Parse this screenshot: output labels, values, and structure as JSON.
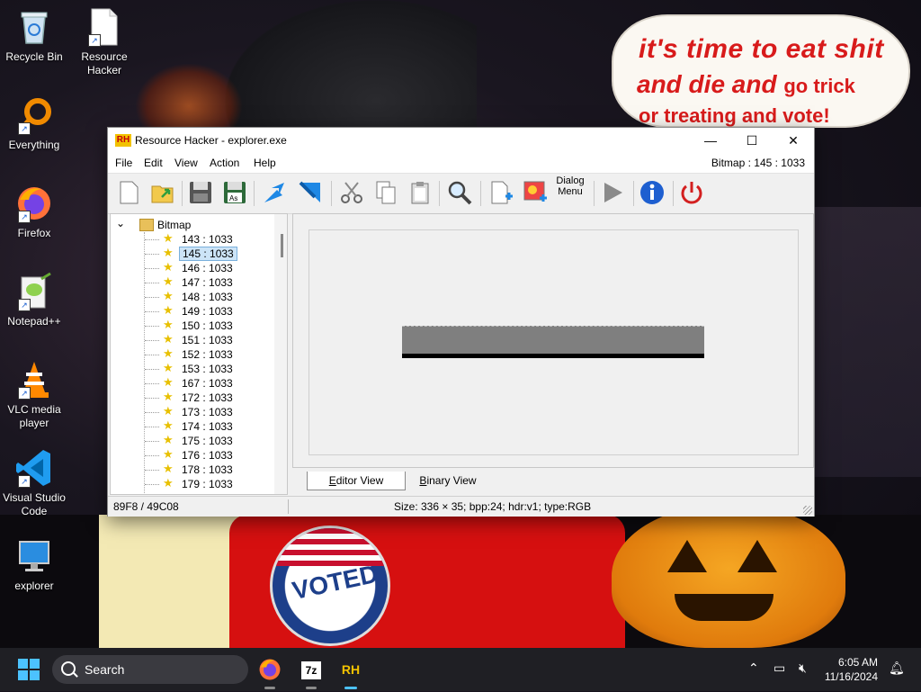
{
  "wallpaper": {
    "speech_line1": "it's time to eat shit",
    "speech_line2a": "and die and",
    "speech_line2b": "go trick",
    "speech_line3": "or treating and vote!",
    "button_text": "I VOTED"
  },
  "desktop_icons": [
    {
      "label": "Recycle Bin"
    },
    {
      "label": "Resource Hacker"
    },
    {
      "label": "Everything"
    },
    {
      "label": "Firefox"
    },
    {
      "label": "Notepad++"
    },
    {
      "label": "VLC media player"
    },
    {
      "label": "Visual Studio Code"
    },
    {
      "label": "explorer"
    }
  ],
  "window": {
    "app_icon_text": "RH",
    "title": "Resource Hacker - explorer.exe",
    "minimize": "—",
    "maximize": "☐",
    "close": "✕",
    "menu": [
      "File",
      "Edit",
      "View",
      "Action",
      "Help"
    ],
    "resource_info": "Bitmap : 145 : 1033",
    "toolbar": {
      "dialog_menu_label1": "Dialog",
      "dialog_menu_label2": "Menu"
    },
    "tree": {
      "root": "Bitmap",
      "items": [
        "143 : 1033",
        "145 : 1033",
        "146 : 1033",
        "147 : 1033",
        "148 : 1033",
        "149 : 1033",
        "150 : 1033",
        "151 : 1033",
        "152 : 1033",
        "153 : 1033",
        "167 : 1033",
        "172 : 1033",
        "173 : 1033",
        "174 : 1033",
        "175 : 1033",
        "176 : 1033",
        "178 : 1033",
        "179 : 1033"
      ],
      "selected_index": 1
    },
    "tabs": {
      "editor_prefix": "E",
      "editor_rest": "ditor View",
      "binary_prefix": "B",
      "binary_rest": "inary View"
    },
    "status_left": "89F8 / 49C08",
    "status_right": "Size: 336 × 35;  bpp:24;  hdr:v1;  type:RGB"
  },
  "taskbar": {
    "search_placeholder": "Search",
    "app_7z": "7z",
    "app_rh": "RH",
    "time": "6:05 AM",
    "date": "11/16/2024"
  },
  "colors": {
    "accent": "#4cc2ff",
    "speech_red": "#d81b1b",
    "rh_icon_bg": "#f2c200"
  }
}
